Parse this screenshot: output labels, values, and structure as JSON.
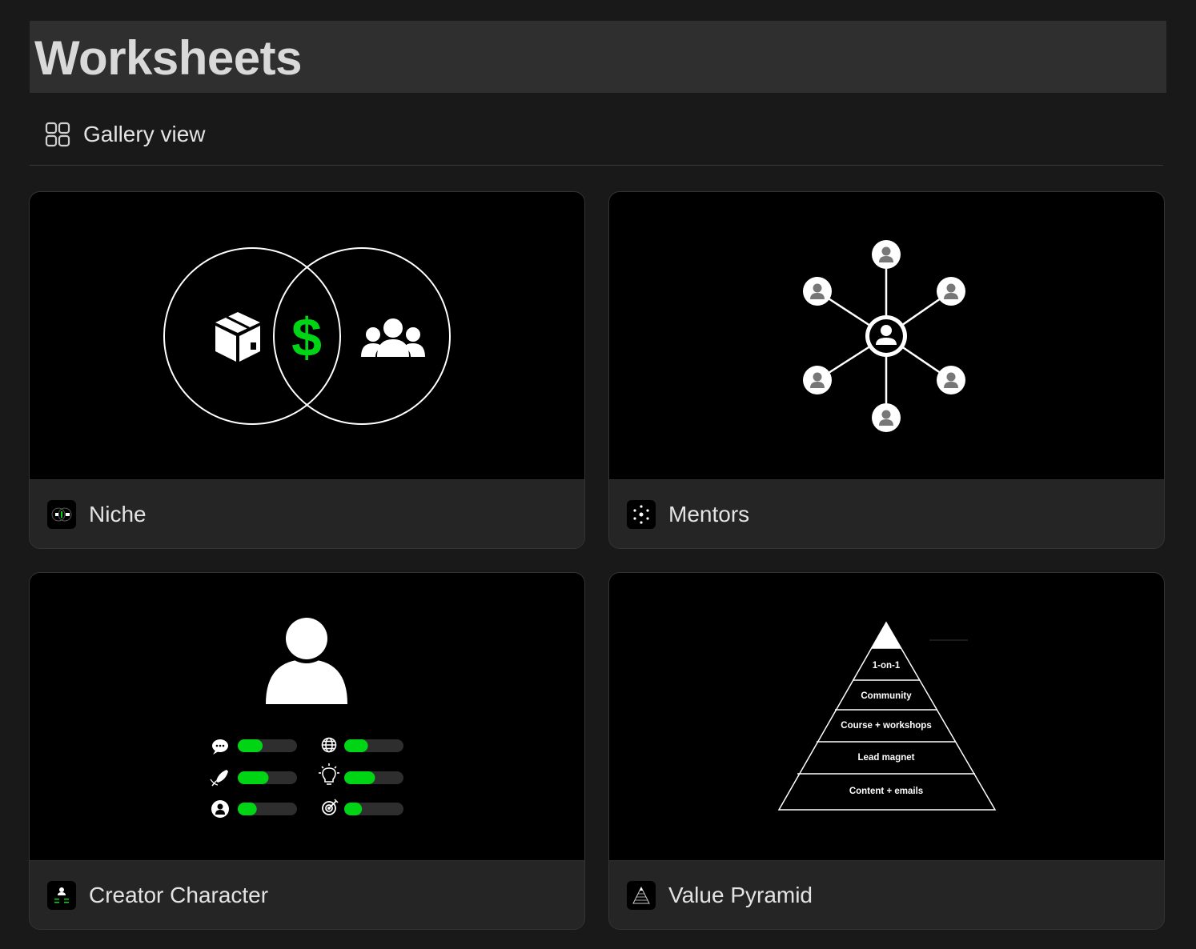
{
  "page": {
    "title": "Worksheets"
  },
  "view": {
    "label": "Gallery view",
    "icon": "gallery-grid-icon"
  },
  "cards": [
    {
      "title": "Niche",
      "icon": "venn-diagram-icon",
      "cover": "niche-venn-cover"
    },
    {
      "title": "Mentors",
      "icon": "network-icon",
      "cover": "mentors-network-cover"
    },
    {
      "title": "Creator Character",
      "icon": "character-icon",
      "cover": "creator-character-cover",
      "stats": [
        {
          "icon": "speech-bubble-icon",
          "level": 0.42
        },
        {
          "icon": "globe-icon",
          "level": 0.4
        },
        {
          "icon": "quill-pen-icon",
          "level": 0.52
        },
        {
          "icon": "lightbulb-icon",
          "level": 0.52
        },
        {
          "icon": "person-icon",
          "level": 0.32
        },
        {
          "icon": "target-icon",
          "level": 0.3
        }
      ]
    },
    {
      "title": "Value Pyramid",
      "icon": "pyramid-icon",
      "cover": "value-pyramid-cover",
      "tiers": [
        "1-on-1",
        "Community",
        "Course + workshops",
        "Lead magnet",
        "Content + emails"
      ]
    }
  ],
  "colors": {
    "accent_green": "#00d515",
    "background": "#191919",
    "card": "#252525"
  }
}
